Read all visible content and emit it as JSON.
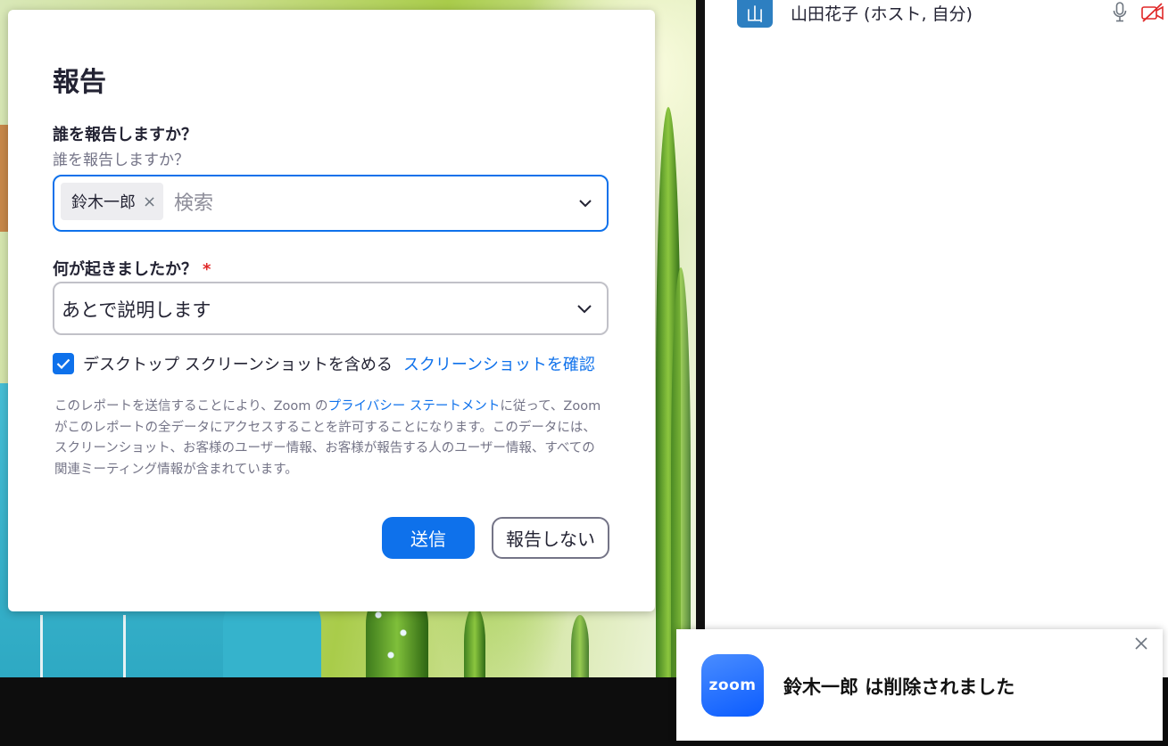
{
  "dialog": {
    "title": "報告",
    "who_label": "誰を報告しますか？",
    "who_sublabel": "誰を報告しますか？",
    "who_selected": "鈴木一郎",
    "chip_remove": "×",
    "search_placeholder": "検索",
    "what_label": "何が起きましたか？",
    "required_mark": "*",
    "what_value": "あとで説明します",
    "checkbox_label": "デスクトップ スクリーンショットを含める",
    "checkbox_checked": true,
    "screenshot_link": "スクリーンショットを確認",
    "disclaimer_before": "このレポートを送信することにより、Zoom の",
    "disclaimer_link": "プライバシー ステートメント",
    "disclaimer_after": "に従って、Zoom がこのレポートの全データにアクセスすることを許可することになります。このデータには、スクリーンショット、お客様のユーザー情報、お客様が報告する人のユーザー情報、すべての関連ミーティング情報が含まれています。",
    "send_button": "送信",
    "cancel_button": "報告しない"
  },
  "participants": [
    {
      "avatar": "山",
      "name": "山田花子 (ホスト, 自分)",
      "mic_icon": "microphone-icon",
      "video_icon": "video-off-icon"
    }
  ],
  "toast": {
    "logo_text": "zoom",
    "message": "鈴木一郎 は削除されました"
  },
  "colors": {
    "accent": "#0e71eb",
    "required": "#e02828",
    "video_off": "#e02828",
    "avatar": "#2d7fc1"
  }
}
